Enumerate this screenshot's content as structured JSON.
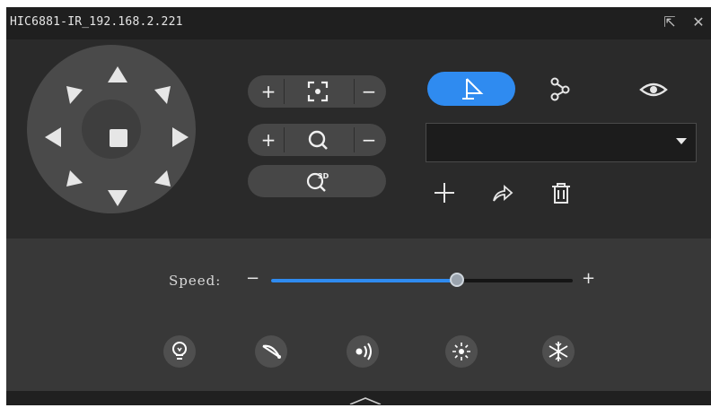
{
  "window": {
    "title": "HIC6881-IR_192.168.2.221",
    "restore_glyph": "⇱",
    "close_glyph": "✕"
  },
  "ptz": {
    "dpad_icons": [
      "arrow-up-icon",
      "arrow-up-right-icon",
      "arrow-right-icon",
      "arrow-down-right-icon",
      "arrow-down-icon",
      "arrow-down-left-icon",
      "arrow-left-icon",
      "arrow-up-left-icon",
      "stop-icon"
    ]
  },
  "lens": {
    "focus": {
      "plus": "+",
      "minus": "−",
      "icon": "focus-icon"
    },
    "zoom": {
      "plus": "+",
      "minus": "−",
      "icon": "zoom-icon"
    },
    "positioning_3d": {
      "icon": "3d-positioning-icon"
    }
  },
  "preset": {
    "tabs": [
      {
        "icon": "preset-flag-icon",
        "active": true
      },
      {
        "icon": "patrol-path-icon",
        "active": false
      },
      {
        "icon": "eye-icon",
        "active": false
      }
    ],
    "dropdown_value": "",
    "actions": [
      "add-icon",
      "goto-icon",
      "delete-icon"
    ],
    "accent_color": "#2f8bf0"
  },
  "speed": {
    "label": "Speed:",
    "minus": "−",
    "plus": "+",
    "value_fraction": 0.615
  },
  "aux": {
    "buttons": [
      "light-icon",
      "wiper-icon",
      "infrared-icon",
      "brightness-icon",
      "defog-icon"
    ]
  }
}
